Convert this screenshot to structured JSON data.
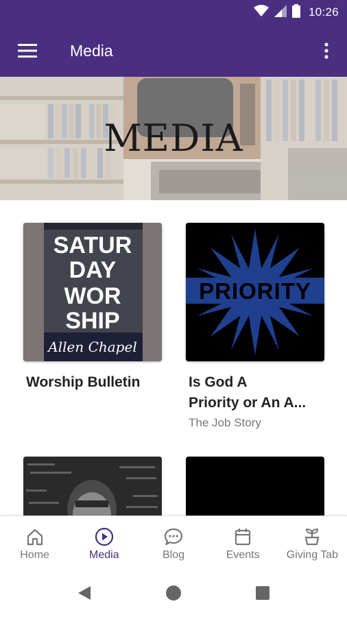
{
  "status_bar": {
    "time": "10:26"
  },
  "app_bar": {
    "title": "Media"
  },
  "banner": {
    "title": "MEDIA"
  },
  "cards": [
    {
      "thumb_lines": [
        "SATUR",
        "DAY",
        "WOR",
        "SHIP"
      ],
      "thumb_script": "Allen Chapel",
      "title": "Worship Bulletin",
      "subtitle": ""
    },
    {
      "thumb_text": "PRIORITY",
      "title_line1": "Is God A",
      "title_line2": "Priority or An A...",
      "subtitle": "The Job Story"
    },
    {
      "title": ""
    },
    {
      "title": ""
    }
  ],
  "bottom_nav": [
    {
      "label": "Home",
      "icon": "home-icon",
      "active": false
    },
    {
      "label": "Media",
      "icon": "play-circle-icon",
      "active": true
    },
    {
      "label": "Blog",
      "icon": "chat-bubble-icon",
      "active": false
    },
    {
      "label": "Events",
      "icon": "calendar-icon",
      "active": false
    },
    {
      "label": "Giving Tab",
      "icon": "plant-pot-icon",
      "active": false
    }
  ],
  "colors": {
    "primary": "#4a2e80",
    "inactive": "#777777",
    "priority_blue": "#1f3f8f"
  }
}
